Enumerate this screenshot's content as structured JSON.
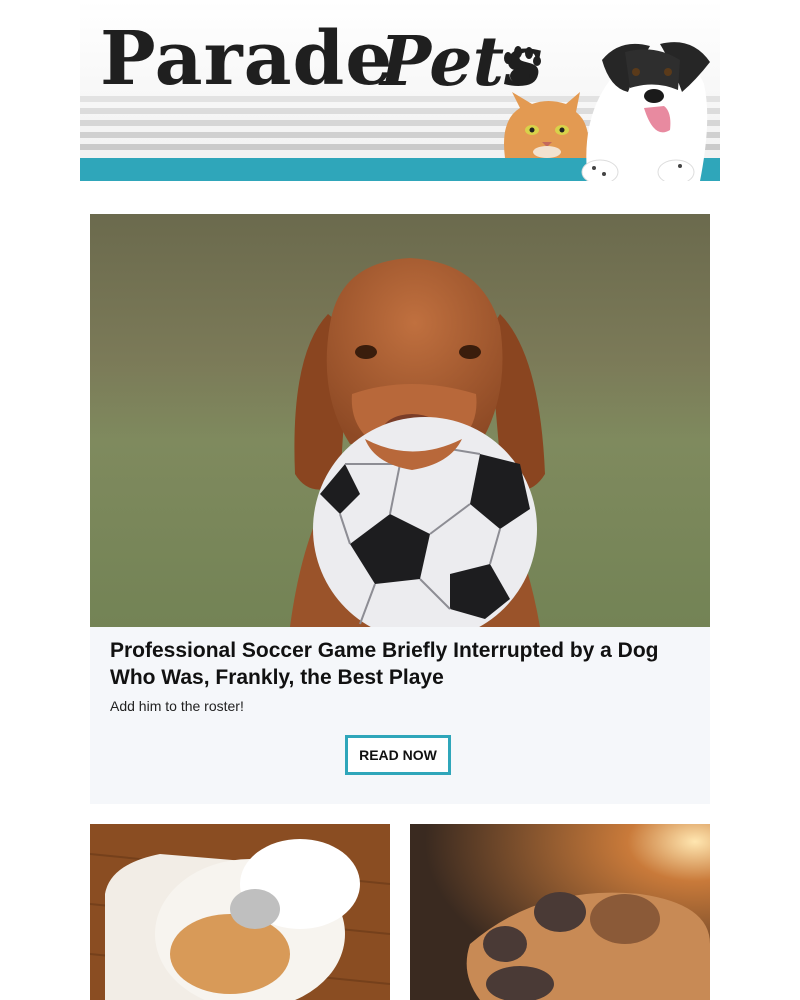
{
  "brand": {
    "logo_word1": "Parade",
    "logo_word2": "Pets",
    "accent_color": "#2fa6ba"
  },
  "hero": {
    "image_alt": "Brown dog holding a soccer ball in its mouth",
    "title": "Professional Soccer Game Briefly Interrupted by a Dog Who Was, Frankly, the Best Playe",
    "subtitle": "Add him to the roster!",
    "button_label": "READ NOW"
  },
  "thumbnails": [
    {
      "image_alt": "Fluffy white and orange cat curled up on a pet bed"
    },
    {
      "image_alt": "Close-up of a dog paw"
    }
  ],
  "icons": {
    "logo_paw": "paw-icon"
  }
}
